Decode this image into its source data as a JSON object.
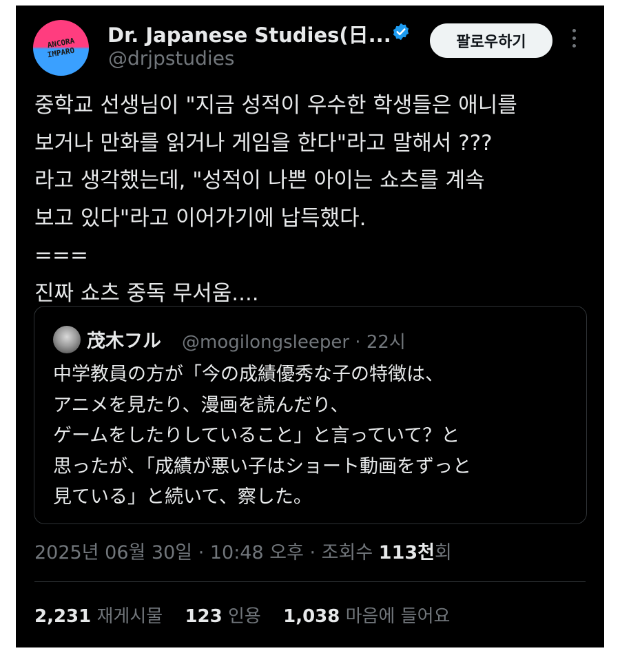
{
  "author": {
    "display_name": "Dr. Japanese Studies(日...",
    "handle": "@drjpstudies",
    "avatar_text_line1": "ANCORA",
    "avatar_text_line2": "IMPARO",
    "verified_icon": "verified-badge-icon"
  },
  "follow_label": "팔로우하기",
  "tweet": {
    "text": "중학교 선생님이 \"지금 성적이 우수한 학생들은 애니를\n보거나 만화를 읽거나 게임을 한다\"라고 말해서 ???\n라고 생각했는데, \"성적이 나쁜 아이는 쇼츠를 계속\n보고 있다\"라고 이어가기에 납득했다.\n===\n진짜 쇼츠 중독 무서움...."
  },
  "quote": {
    "name": "茂木フル",
    "handle_time": "@mogilongsleeper · 22시",
    "text": "中学教員の方が「今の成績優秀な子の特徴は、\nアニメを見たり、漫画を読んだり、\nゲームをしたりしていること」と言っていて？と\n思ったが、「成績が悪い子はショート動画をずっと\n見ている」と続いて、察した。"
  },
  "meta": {
    "timestamp": "2025년 06월 30일 · 10:48 오후 · 조회수 ",
    "views": "113천",
    "views_suffix": "회"
  },
  "stats": {
    "reposts_count": "2,231",
    "reposts_label": "재게시물",
    "quotes_count": "123",
    "quotes_label": "인용",
    "likes_count": "1,038",
    "likes_label": "마음에 들어요"
  },
  "colors": {
    "background": "#000000",
    "text": "#e7e9ea",
    "secondary_text": "#71767b",
    "verified": "#1d9bf0",
    "border": "#2f3336"
  }
}
